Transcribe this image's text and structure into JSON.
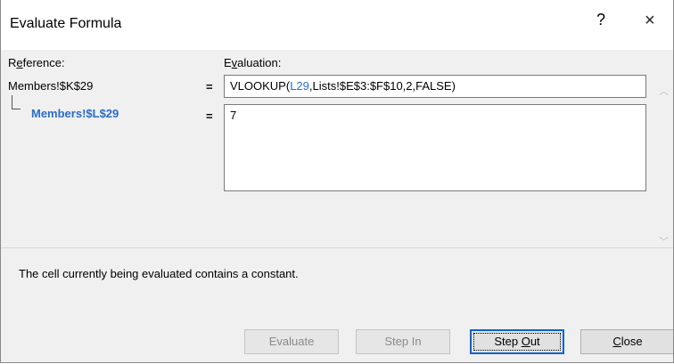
{
  "window": {
    "title": "Evaluate Formula",
    "help_label": "?",
    "close_label": "×"
  },
  "reference": {
    "label_pre": "R",
    "label_ul": "e",
    "label_post": "ference:",
    "main": "Members!$K$29",
    "sub": "Members!$L$29"
  },
  "evaluation": {
    "label_pre": "E",
    "label_ul": "v",
    "label_post": "aluation:",
    "equals": "=",
    "formula_pre": "VLOOKUP(",
    "formula_highlight": "L29",
    "formula_post": ",Lists!$E$3:$F$10,2,FALSE)",
    "sub_value": "7"
  },
  "status": "The cell currently being evaluated contains a constant.",
  "buttons": {
    "evaluate": "Evaluate",
    "step_in": "Step In",
    "step_out_pre": "Step ",
    "step_out_ul": "O",
    "step_out_post": "ut",
    "close_ul": "C",
    "close_post": "lose"
  },
  "colors": {
    "accent": "#2b6cc9",
    "focus": "#0a64c8"
  }
}
